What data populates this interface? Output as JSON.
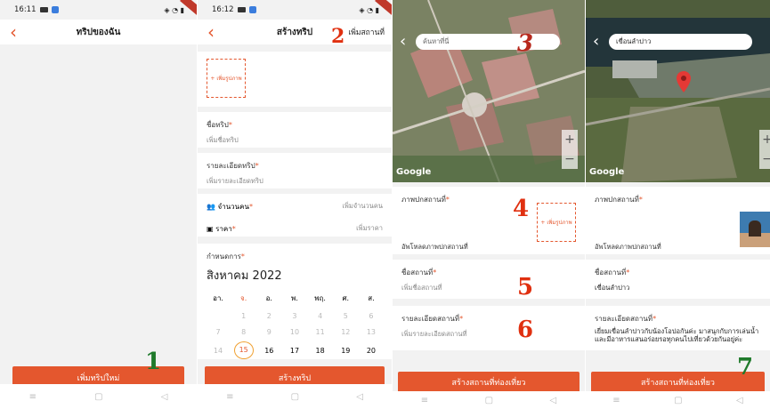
{
  "screens": {
    "s1": {
      "time": "16:11",
      "title": "ทริปของฉัน",
      "button": "เพิ่มทริปใหม่",
      "step": "1"
    },
    "s2": {
      "time": "16:12",
      "title": "สร้างทริป",
      "action": "เพิ่มสถานที่",
      "step": "2",
      "photo_add": "+ เพิ่มรูปภาพ",
      "trip_name_label": "ชื่อทริป",
      "trip_name_placeholder": "เพิ่มชื่อทริป",
      "trip_detail_label": "รายละเอียดทริป",
      "trip_detail_placeholder": "เพิ่มรายละเอียดทริป",
      "people_label": "จำนวนคน",
      "people_placeholder": "เพิ่มจำนวนคน",
      "price_label": "ราคา",
      "price_placeholder": "เพิ่มราคา",
      "schedule_label": "กำหนดการ",
      "month": "สิงหาคม 2022",
      "weekdays": [
        "อา.",
        "จ.",
        "อ.",
        "พ.",
        "พฤ.",
        "ศ.",
        "ส."
      ],
      "week1": [
        "",
        "1",
        "2",
        "3",
        "4",
        "5",
        "6"
      ],
      "week2": [
        "7",
        "8",
        "9",
        "10",
        "11",
        "12",
        "13"
      ],
      "week3": [
        "14",
        "15",
        "16",
        "17",
        "18",
        "19",
        "20"
      ],
      "button": "สร้างทริป"
    },
    "s3": {
      "search_placeholder": "ค้นหาที่นี่",
      "step": "3",
      "google": "Google",
      "photo_label": "ภาพปกสถานที่",
      "upload_label": "อัพโหลดภาพปกสถานที่",
      "photo_add": "+ เพิ่มรูปภาพ",
      "step4": "4",
      "place_name_label": "ชื่อสถานที่",
      "place_name_placeholder": "เพิ่มชื่อสถานที่",
      "step5": "5",
      "place_detail_label": "รายละเอียดสถานที่",
      "place_detail_placeholder": "เพิ่มรายละเอียดสถานที่",
      "step6": "6",
      "button": "สร้างสถานที่ท่องเที่ยว"
    },
    "s4": {
      "search_value": "เขื่อนลำปาว",
      "google": "Google",
      "photo_label": "ภาพปกสถานที่",
      "upload_label": "อัพโหลดภาพปกสถานที่",
      "place_name_label": "ชื่อสถานที่",
      "place_name_value": "เขื่อนลำปาว",
      "place_detail_label": "รายละเอียดสถานที่",
      "place_detail_value": "เยี่ยมเขื่อนลำปาวกับน้องโอปอกันค่ะ มาสนุกกับการเล่นน้ำและมีอาหารแสนอร่อยรอทุกคนไปเที่ยวด้วยกันอยู่ค่ะ",
      "button": "สร้างสถานที่ท่องเที่ยว",
      "step": "7"
    }
  },
  "nav": {
    "menu": "≡",
    "home": "▢",
    "back": "◁"
  },
  "colors": {
    "accent": "#e4572e",
    "step_red": "#e03010",
    "step_green": "#1f7a2b"
  }
}
